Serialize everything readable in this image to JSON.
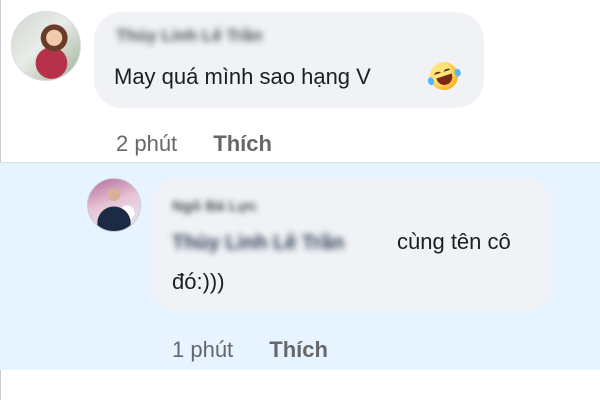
{
  "comment": {
    "author": "Thùy Linh Lê Trần",
    "text": "May quá mình sao hạng V",
    "emoji": "rolling-on-floor-laughing-icon",
    "time": "2 phút",
    "like_label": "Thích"
  },
  "reply": {
    "author": "Ngô Bá Lực",
    "mention": "Thùy Linh Lê Trần",
    "text_line1": "cùng tên cô",
    "text_line2": "đó:)))",
    "time": "1 phút",
    "like_label": "Thích"
  },
  "colors": {
    "bubble": "#f0f2f5",
    "reply_highlight": "#e7f3ff",
    "meta_text": "#65676b",
    "body_text": "#1c1e21"
  }
}
